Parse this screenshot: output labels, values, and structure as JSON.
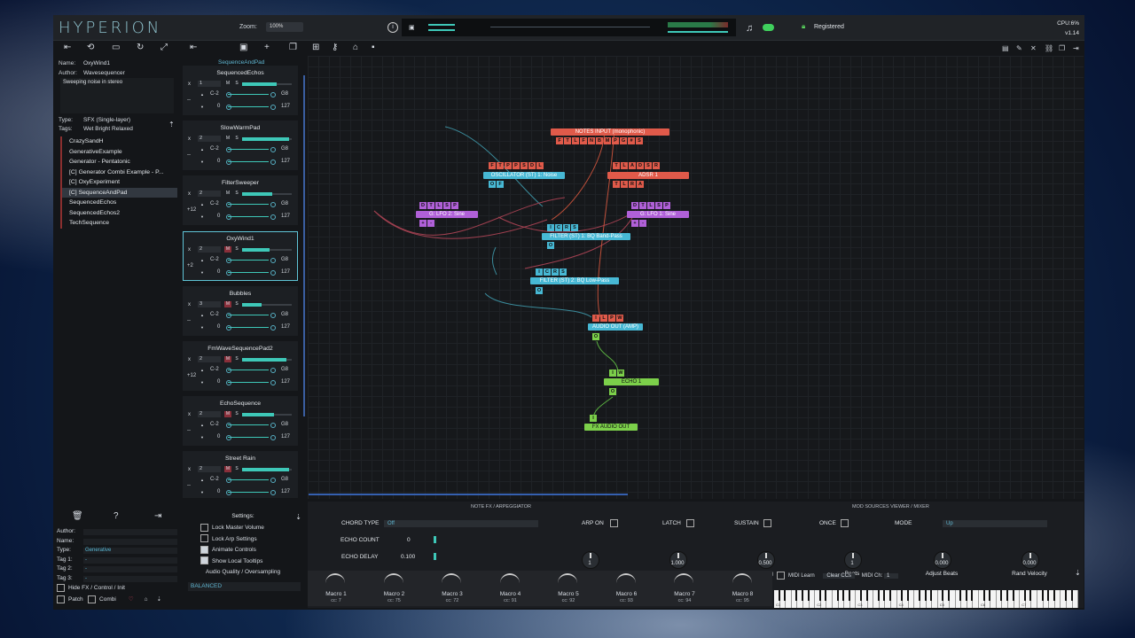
{
  "app": {
    "logo": "HYPERION",
    "zoom_label": "Zoom:",
    "zoom_value": "100%",
    "registered": "Registered",
    "cpu": "CPU:6%",
    "version": "v1.14"
  },
  "breadcrumb": "SequenceAndPad",
  "patch": {
    "name_label": "Name:",
    "name": "OxyWind1",
    "author_label": "Author:",
    "author": "Wavesequencer",
    "description": "Sweeping noise in stereo",
    "type_label": "Type:",
    "type": "SFX (Single-layer)",
    "tags_label": "Tags:",
    "tags": "Wet Bright Relaxed"
  },
  "presets": [
    "CrazySandH",
    "GenerativeExample",
    "Generator - Pentatonic",
    "[C] Generator Combi Example - P...",
    "[C] OxyExperiment",
    "[C] SequenceAndPad",
    "SequencedEchos",
    "SequencedEchos2",
    "TechSequence"
  ],
  "selected_preset_index": 5,
  "slots": [
    {
      "name": "SequencedEchos",
      "channel": "1",
      "muted": false,
      "transpose": "--",
      "low": "C-2",
      "high": "G8",
      "vmin": "0",
      "vmax": "127",
      "vol": 0.7
    },
    {
      "name": "SlowWarmPad",
      "channel": "2",
      "muted": false,
      "transpose": "--",
      "low": "C-2",
      "high": "G8",
      "vmin": "0",
      "vmax": "127",
      "vol": 0.95
    },
    {
      "name": "FilterSweeper",
      "channel": "2",
      "muted": false,
      "transpose": "+12",
      "low": "C-2",
      "high": "G8",
      "vmin": "0",
      "vmax": "127",
      "vol": 0.6
    },
    {
      "name": "OxyWind1",
      "channel": "2",
      "muted": true,
      "transpose": "+2",
      "low": "C-2",
      "high": "G8",
      "vmin": "0",
      "vmax": "127",
      "vol": 0.55
    },
    {
      "name": "Bubbles",
      "channel": "3",
      "muted": true,
      "transpose": "--",
      "low": "C-2",
      "high": "G8",
      "vmin": "0",
      "vmax": "127",
      "vol": 0.4
    },
    {
      "name": "FmWaveSequencePad2",
      "channel": "2",
      "muted": true,
      "transpose": "+12",
      "low": "C-2",
      "high": "G8",
      "vmin": "0",
      "vmax": "127",
      "vol": 0.9
    },
    {
      "name": "EchoSequence",
      "channel": "2",
      "muted": true,
      "transpose": "--",
      "low": "C-2",
      "high": "G8",
      "vmin": "0",
      "vmax": "127",
      "vol": 0.65
    },
    {
      "name": "Street Rain",
      "channel": "2",
      "muted": true,
      "transpose": "--",
      "low": "C-2",
      "high": "G8",
      "vmin": "0",
      "vmax": "127",
      "vol": 0.95
    }
  ],
  "slot_labels": {
    "x": "x",
    "m": "M",
    "s": "S"
  },
  "settings": {
    "title": "Settings:",
    "items": [
      "Lock Master Volume",
      "Lock Arp Settings",
      "Animate Controls",
      "Show Local Tooltips"
    ],
    "checked": [
      false,
      false,
      true,
      true
    ],
    "quality_label": "Audio Quality / Oversampling",
    "quality": "BALANCED"
  },
  "left_fields": {
    "author": "Author:",
    "name": "Name:",
    "type": "Type:",
    "type_value": "Generative",
    "tag1": "Tag 1:",
    "tag2": "Tag 2:",
    "tag3": "Tag 3:",
    "tag_value": "-",
    "hide_fx": "Hide FX / Control / Init",
    "patch": "Patch",
    "combi": "Combi"
  },
  "nodes": {
    "notes_input": "NOTES INPUT (monophonic)",
    "notes_pins": [
      "F",
      "T",
      "L",
      "F",
      "N",
      "B",
      "M",
      "P",
      "G",
      "#",
      "S"
    ],
    "osc": "OSCILLATOR (ST) 1: Noise",
    "osc_pins": [
      "F",
      "T",
      "P",
      "P",
      "S",
      "D",
      "L"
    ],
    "osc_out": [
      "O",
      "F"
    ],
    "adsr": "ADSR 1",
    "adsr_pins": [
      "T",
      "L",
      "A",
      "D",
      "S",
      "R"
    ],
    "adsr_out": [
      "T",
      "L",
      "R",
      "A"
    ],
    "lfo2": "G: LFO 2: Sine",
    "lfo2_pins": [
      "D",
      "T",
      "L",
      "S",
      "P"
    ],
    "lfo2_out": [
      "+",
      "-"
    ],
    "lfo1": "G: LFO 1: Sine",
    "lfo1_pins": [
      "D",
      "T",
      "L",
      "S",
      "P"
    ],
    "lfo1_out": [
      "+",
      "-"
    ],
    "filter1": "FILTER (ST) 1: BQ Band-Pass",
    "filter1_pins": [
      "I",
      "C",
      "R",
      "S"
    ],
    "filter1_out": [
      "O"
    ],
    "filter2": "FILTER (ST) 2: BQ Low-Pass",
    "filter2_pins": [
      "I",
      "C",
      "R",
      "S"
    ],
    "filter2_out": [
      "O"
    ],
    "amp": "AUDIO OUT (AMP)",
    "amp_pins": [
      "I",
      "L",
      "P",
      "W"
    ],
    "amp_out": [
      "O"
    ],
    "echo": "ECHO 1",
    "echo_pins": [
      "I",
      "W"
    ],
    "echo_out": [
      "O"
    ],
    "fxout": "FX AUDIO OUT",
    "fxout_pins": [
      "I"
    ]
  },
  "bottom": {
    "tab_left": "NOTE FX / ARPEGGIATOR",
    "tab_right": "MOD SOURCES VIEWER / MIXER",
    "chord_type_label": "CHORD TYPE",
    "chord_type": "Off",
    "echo_count_label": "ECHO COUNT",
    "echo_count": "0",
    "echo_delay_label": "ECHO DELAY",
    "echo_delay": "0.100",
    "arp_on": "ARP ON",
    "latch": "LATCH",
    "sustain": "SUSTAIN",
    "once": "ONCE",
    "mode_label": "MODE",
    "mode": "Up",
    "knobs": [
      {
        "label": "Range",
        "value": "1"
      },
      {
        "label": "Gate",
        "value": "1.000"
      },
      {
        "label": "Swing",
        "value": "0.500"
      },
      {
        "label": "Beats",
        "value": "1"
      },
      {
        "label": "Adjust Beats",
        "value": "0.000"
      },
      {
        "label": "Rand Velocity",
        "value": "0.000"
      }
    ],
    "macros": [
      {
        "name": "Macro 1",
        "cc": "cc:  7"
      },
      {
        "name": "Macro 2",
        "cc": "cc:  75"
      },
      {
        "name": "Macro 3",
        "cc": "cc:  72"
      },
      {
        "name": "Macro 4",
        "cc": "cc:  91"
      },
      {
        "name": "Macro 5",
        "cc": "cc:  92"
      },
      {
        "name": "Macro 6",
        "cc": "cc:  93"
      },
      {
        "name": "Macro 7",
        "cc": "cc:  94"
      },
      {
        "name": "Macro 8",
        "cc": "cc:  95"
      }
    ],
    "midi_learn": "MIDI Learn",
    "clear_ccs": "Clear CCs",
    "midi_ch_label": "MIDI Ch:",
    "midi_ch": "1",
    "octaves": [
      "C1",
      "C2",
      "C3",
      "C4",
      "C5",
      "C6",
      "C7"
    ]
  },
  "colors": {
    "accent": "#47b8d4",
    "red": "#e05a4a",
    "purple": "#b060d8",
    "green": "#7cd04a"
  }
}
